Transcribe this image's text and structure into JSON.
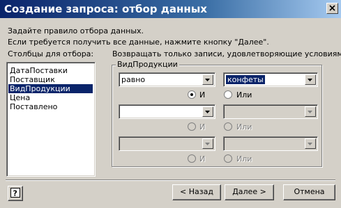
{
  "window": {
    "title": "Создание запроса: отбор данных"
  },
  "instructions": {
    "line1": "Задайте правило отбора данных.",
    "line2": "Если требуется получить все данные, нажмите кнопку \"Далее\"."
  },
  "columns": {
    "label": "Столбцы для отбора:",
    "items": [
      "ДатаПоставки",
      "Поставщик",
      "ВидПродукции",
      "Цена",
      "Поставлено"
    ],
    "selected": "ВидПродукции"
  },
  "conditions": {
    "label": "Возвращать только записи, удовлетворяющие условиям:",
    "group_title": "ВидПродукции",
    "rows": [
      {
        "operator": "равно",
        "value": "конфеты",
        "and_label": "И",
        "or_label": "Или",
        "selected": "and"
      },
      {
        "operator": "",
        "value": "",
        "and_label": "И",
        "or_label": "Или",
        "selected": ""
      },
      {
        "operator": "",
        "value": "",
        "and_label": "И",
        "or_label": "Или",
        "selected": ""
      }
    ]
  },
  "buttons": {
    "back": "< Назад",
    "next": "Далее >",
    "cancel": "Отмена"
  },
  "icons": {
    "help": "help-icon",
    "close": "close-icon",
    "dropdown": "dropdown-arrow-icon"
  },
  "colors": {
    "title_bar_start": "#0a246a",
    "title_bar_end": "#a6caf0",
    "selection": "#0a246a",
    "face": "#d4d0c8"
  }
}
